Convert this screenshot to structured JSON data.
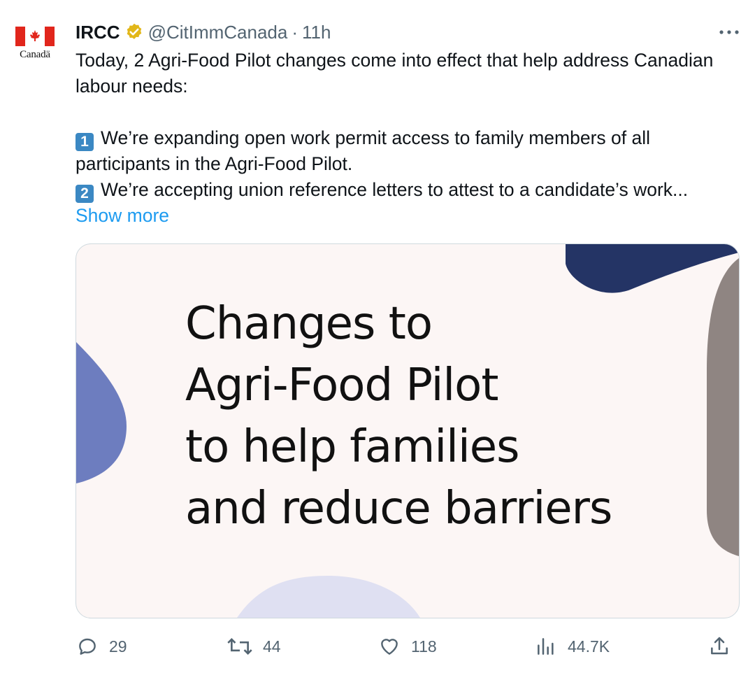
{
  "tweet": {
    "author": {
      "name": "IRCC",
      "handle": "@CitImmCanada",
      "separator": "·",
      "time": "11h",
      "avatar_text": "Canadä"
    },
    "text": {
      "intro": "Today, 2 Agri-Food Pilot changes come into effect that help address Canadian labour needs:",
      "item1_badge": "1",
      "item1": "We’re expanding open work permit access to family members of all participants in the Agri-Food Pilot.",
      "item2_badge": "2",
      "item2": "We’re accepting union reference letters to attest to a candidate’s work...",
      "show_more": "Show more"
    },
    "card": {
      "headline_lines": [
        "Changes to",
        "Agri-Food Pilot",
        "to help families",
        "and reduce barriers"
      ]
    },
    "actions": {
      "replies": "29",
      "retweets": "44",
      "likes": "118",
      "views": "44.7K"
    },
    "icons": {
      "verified": "verified-badge-icon",
      "more": "more-options-icon",
      "reply": "reply-icon",
      "retweet": "retweet-icon",
      "like": "heart-icon",
      "views": "views-chart-icon",
      "share": "share-icon"
    },
    "colors": {
      "accent": "#1d9bf0",
      "muted": "#536471",
      "verified_gold": "#e2b719",
      "card_bg": "#fcf6f5",
      "navy": "#243465",
      "periwinkle": "#6d7dbf",
      "taupe": "#8f8582",
      "lavender": "#dfe0f2"
    }
  }
}
